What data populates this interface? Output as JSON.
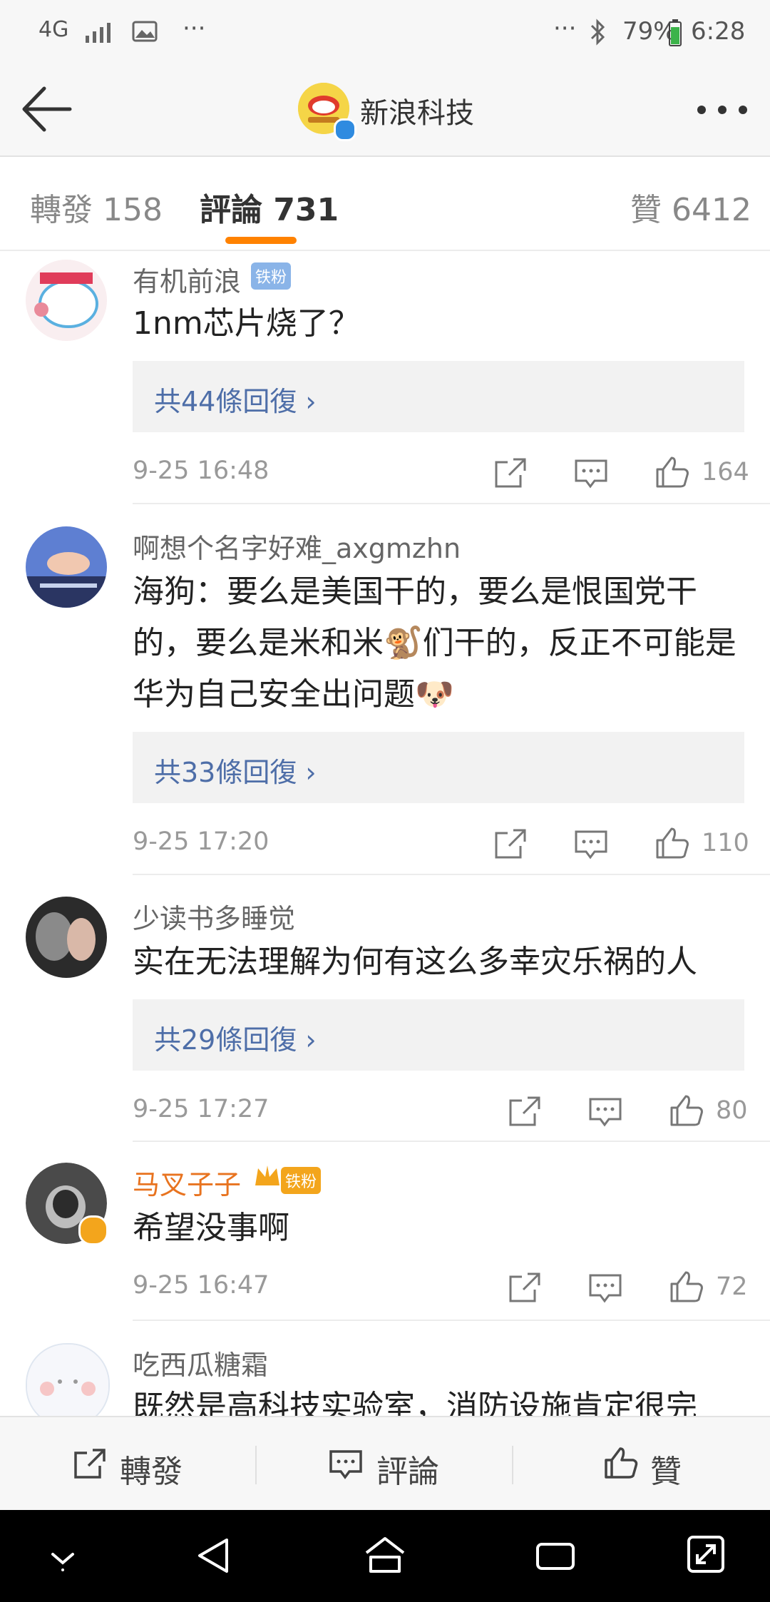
{
  "status_bar": {
    "network": "4G",
    "battery": "79%",
    "time": "6:28"
  },
  "header": {
    "title": "新浪科技",
    "logo_text": "sina 新浪科技"
  },
  "tabs": [
    {
      "label": "轉發 158"
    },
    {
      "label": "評論 731"
    },
    {
      "label": "贊 6412"
    }
  ],
  "comments": [
    {
      "user": "有机前浪",
      "badge": "铁粉",
      "text": "1nm芯片烧了？",
      "replies": "共44條回復 ›",
      "time": "9-25 16:48",
      "likes": "164"
    },
    {
      "user": "啊想个名字好难_axgmzhn",
      "text": "海狗：要么是美国干的，要么是恨国党干的，要么是米和米🐒们干的，反正不可能是华为自己安全出问题🐶",
      "replies": "共33條回復 ›",
      "time": "9-25 17:20",
      "likes": "110"
    },
    {
      "user": "少读书多睡觉",
      "text": "实在无法理解为何有这么多幸灾乐祸的人",
      "replies": "共29條回復 ›",
      "time": "9-25 17:27",
      "likes": "80"
    },
    {
      "user": "马叉子子",
      "badge": "铁粉",
      "text": "希望没事啊",
      "time": "9-25 16:47",
      "likes": "72"
    },
    {
      "user": "吃西瓜糖霜",
      "text": "既然是高科技实验室，消防设施肯定很完"
    }
  ],
  "toolbar": {
    "repost": "轉發",
    "comment": "評論",
    "like": "贊"
  },
  "colors": {
    "accent": "#ff8200",
    "link": "#4e6ea8",
    "vip_name": "#e8731f"
  }
}
